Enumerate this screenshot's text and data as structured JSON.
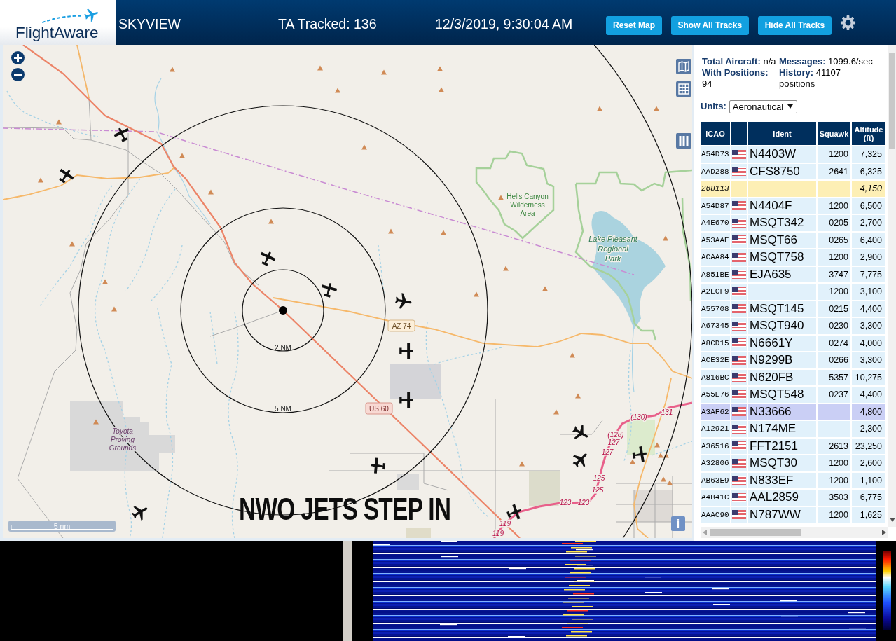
{
  "header": {
    "logo": "FlightAware",
    "title": "SKYVIEW",
    "tracked": "TA Tracked: 136",
    "datetime": "12/3/2019, 9:30:04 AM",
    "buttons": [
      "Reset Map",
      "Show All Tracks",
      "Hide All Tracks"
    ]
  },
  "map": {
    "place_labels": [
      {
        "lines": [
          "Hells Canyon",
          "Wilderness",
          "Area"
        ],
        "kind": "wilderness"
      },
      {
        "lines": [
          "Lake Pleasant",
          "Regional",
          "Park"
        ],
        "kind": "park"
      },
      {
        "lines": [
          "Toyota",
          "Proving",
          "Grounds"
        ],
        "kind": "landuse"
      }
    ],
    "road_shields": [
      {
        "label": "AZ 74",
        "kind": "state"
      },
      {
        "label": "US 60",
        "kind": "us"
      }
    ],
    "route_markers": [
      "(130)",
      "131",
      "(128)",
      "127",
      "127",
      "125",
      "125",
      "123",
      "123",
      "119",
      "119"
    ],
    "range_ring_labels": [
      "2 NM",
      "5 NM"
    ],
    "scale": "5 nm",
    "info_button": "i",
    "caption": "NWO JETS STEP IN"
  },
  "stats": [
    {
      "label": "Total Aircraft:",
      "value": "n/a"
    },
    {
      "label": "Messages:",
      "value": "1099.6/sec"
    },
    {
      "label": "With Positions:",
      "value": "94"
    },
    {
      "label": "History:",
      "value": "41107",
      "unit": "positions"
    }
  ],
  "units": {
    "label": "Units:",
    "value": "Aeronautical"
  },
  "table": {
    "columns": [
      {
        "kind": "text",
        "label": "ICAO"
      },
      {
        "kind": "flag"
      },
      {
        "kind": "text",
        "label": "Ident"
      },
      {
        "kind": "text",
        "label": "Squawk"
      },
      {
        "kind": "text",
        "label": "Altitude (ft)"
      }
    ],
    "rows": [
      {
        "icao": "A54D73",
        "flag": true,
        "ident": "N4403W",
        "squawk": "1200",
        "altitude": "7,325",
        "kind": "adsb",
        "selected": false
      },
      {
        "icao": "AAD288",
        "flag": true,
        "ident": "CFS8750",
        "squawk": "2641",
        "altitude": "6,325",
        "kind": "adsb",
        "selected": false
      },
      {
        "icao": "268113",
        "flag": false,
        "altitude": "4,150",
        "kind": "other",
        "selected": false
      },
      {
        "icao": "A54D87",
        "flag": true,
        "ident": "N4404F",
        "squawk": "1200",
        "altitude": "6,500",
        "kind": "adsb",
        "selected": false
      },
      {
        "icao": "A4E670",
        "flag": true,
        "ident": "MSQT342",
        "squawk": "0205",
        "altitude": "2,700",
        "kind": "adsb",
        "selected": false
      },
      {
        "icao": "A53AAE",
        "flag": true,
        "ident": "MSQT66",
        "squawk": "0265",
        "altitude": "6,400",
        "kind": "adsb",
        "selected": false
      },
      {
        "icao": "ACAA84",
        "flag": true,
        "ident": "MSQT758",
        "squawk": "1200",
        "altitude": "2,900",
        "kind": "adsb",
        "selected": false
      },
      {
        "icao": "A851BE",
        "flag": true,
        "ident": "EJA635",
        "squawk": "3747",
        "altitude": "7,775",
        "kind": "adsb",
        "selected": false
      },
      {
        "icao": "A2ECF9",
        "flag": true,
        "squawk": "1200",
        "altitude": "3,100",
        "kind": "adsb",
        "selected": false
      },
      {
        "icao": "A55708",
        "flag": true,
        "ident": "MSQT145",
        "squawk": "0215",
        "altitude": "4,400",
        "kind": "adsb",
        "selected": false
      },
      {
        "icao": "A67345",
        "flag": true,
        "ident": "MSQT940",
        "squawk": "0230",
        "altitude": "3,300",
        "kind": "adsb",
        "selected": false
      },
      {
        "icao": "A8CD15",
        "flag": true,
        "ident": "N6661Y",
        "squawk": "0274",
        "altitude": "4,000",
        "kind": "adsb",
        "selected": false
      },
      {
        "icao": "ACE32E",
        "flag": true,
        "ident": "N9299B",
        "squawk": "0266",
        "altitude": "3,300",
        "kind": "adsb",
        "selected": false
      },
      {
        "icao": "A816BC",
        "flag": true,
        "ident": "N620FB",
        "squawk": "5357",
        "altitude": "10,275",
        "kind": "adsb",
        "selected": false
      },
      {
        "icao": "A55E76",
        "flag": true,
        "ident": "MSQT548",
        "squawk": "0237",
        "altitude": "4,400",
        "kind": "adsb",
        "selected": false
      },
      {
        "icao": "A3AF62",
        "flag": true,
        "ident": "N33666",
        "altitude": "4,800",
        "kind": "adsb",
        "selected": true
      },
      {
        "icao": "A12921",
        "flag": true,
        "ident": "N174ME",
        "altitude": "2,300",
        "kind": "adsb",
        "selected": false
      },
      {
        "icao": "A36516",
        "flag": true,
        "ident": "FFT2151",
        "squawk": "2613",
        "altitude": "23,250",
        "kind": "adsb",
        "selected": false
      },
      {
        "icao": "A32806",
        "flag": true,
        "ident": "MSQT30",
        "squawk": "1200",
        "altitude": "2,600",
        "kind": "adsb",
        "selected": false
      },
      {
        "icao": "AB63E9",
        "flag": true,
        "ident": "N833EF",
        "squawk": "1200",
        "altitude": "1,100",
        "kind": "adsb",
        "selected": false
      },
      {
        "icao": "A4B41C",
        "flag": true,
        "ident": "AAL2859",
        "squawk": "3503",
        "altitude": "6,775",
        "kind": "adsb",
        "selected": false
      },
      {
        "icao": "AAAC90",
        "flag": true,
        "ident": "N787WW",
        "squawk": "1200",
        "altitude": "1,625",
        "kind": "adsb",
        "selected": false
      }
    ]
  }
}
